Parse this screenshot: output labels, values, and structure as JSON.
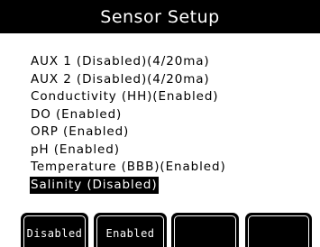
{
  "header": {
    "title": "Sensor Setup"
  },
  "menu": {
    "items": [
      {
        "label": "AUX 1 (Disabled)(4/20ma)",
        "selected": false
      },
      {
        "label": "AUX 2 (Disabled)(4/20ma)",
        "selected": false
      },
      {
        "label": "Conductivity (HH)(Enabled)",
        "selected": false
      },
      {
        "label": "DO (Enabled)",
        "selected": false
      },
      {
        "label": "ORP (Enabled)",
        "selected": false
      },
      {
        "label": "pH (Enabled)",
        "selected": false
      },
      {
        "label": "Temperature (BBB)(Enabled)",
        "selected": false
      },
      {
        "label": "Salinity (Disabled)",
        "selected": true
      }
    ]
  },
  "softkeys": [
    {
      "label": "Disabled"
    },
    {
      "label": "Enabled"
    },
    {
      "label": ""
    },
    {
      "label": ""
    }
  ],
  "colors": {
    "background": "#ffffff",
    "foreground": "#000000",
    "highlight": "#000000"
  }
}
